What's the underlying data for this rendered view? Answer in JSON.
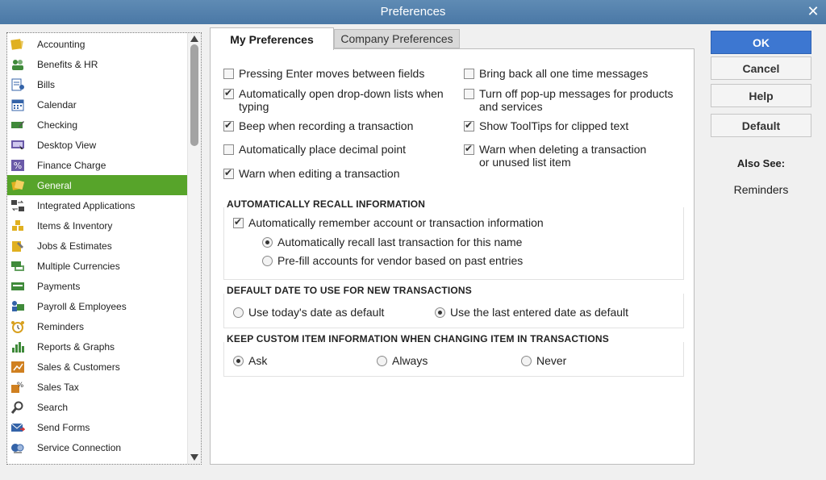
{
  "window": {
    "title": "Preferences",
    "close_glyph": "✕"
  },
  "sidebar": {
    "items": [
      {
        "label": "Accounting",
        "icon": "accounting-icon",
        "color": "#e0b020"
      },
      {
        "label": "Benefits & HR",
        "icon": "people-icon",
        "color": "#3f8a3a"
      },
      {
        "label": "Bills",
        "icon": "bills-icon",
        "color": "#3463a8"
      },
      {
        "label": "Calendar",
        "icon": "calendar-icon",
        "color": "#3463a8"
      },
      {
        "label": "Checking",
        "icon": "checking-icon",
        "color": "#3f8a3a"
      },
      {
        "label": "Desktop View",
        "icon": "desktop-icon",
        "color": "#6a5aa8"
      },
      {
        "label": "Finance Charge",
        "icon": "percent-icon",
        "color": "#6a5aa8"
      },
      {
        "label": "General",
        "icon": "general-icon",
        "color": "#e0b020"
      },
      {
        "label": "Integrated Applications",
        "icon": "integrated-apps-icon",
        "color": "#444"
      },
      {
        "label": "Items & Inventory",
        "icon": "inventory-icon",
        "color": "#e0b020"
      },
      {
        "label": "Jobs & Estimates",
        "icon": "jobs-icon",
        "color": "#e0b020"
      },
      {
        "label": "Multiple Currencies",
        "icon": "currencies-icon",
        "color": "#3f8a3a"
      },
      {
        "label": "Payments",
        "icon": "payments-icon",
        "color": "#3f8a3a"
      },
      {
        "label": "Payroll & Employees",
        "icon": "payroll-icon",
        "color": "#3f8a3a"
      },
      {
        "label": "Reminders",
        "icon": "alarm-clock-icon",
        "color": "#d8a020"
      },
      {
        "label": "Reports & Graphs",
        "icon": "bar-chart-icon",
        "color": "#3f8a3a"
      },
      {
        "label": "Sales & Customers",
        "icon": "sales-icon",
        "color": "#d08020"
      },
      {
        "label": "Sales Tax",
        "icon": "sales-tax-icon",
        "color": "#d08020"
      },
      {
        "label": "Search",
        "icon": "search-icon",
        "color": "#444"
      },
      {
        "label": "Send Forms",
        "icon": "send-forms-icon",
        "color": "#3463a8"
      },
      {
        "label": "Service Connection",
        "icon": "service-connection-icon",
        "color": "#3463a8"
      }
    ],
    "selected_index": 7
  },
  "tabs": [
    {
      "label": "My Preferences",
      "active": true
    },
    {
      "label": "Company Preferences",
      "active": false
    }
  ],
  "options": {
    "left": [
      {
        "label": "Pressing Enter moves between fields",
        "checked": false
      },
      {
        "label": "Automatically open drop-down lists when typing",
        "checked": true
      },
      {
        "label": "Beep when recording a transaction",
        "checked": true
      },
      {
        "label": "Automatically place decimal point",
        "checked": false
      },
      {
        "label": "Warn when editing a transaction",
        "checked": true
      }
    ],
    "right": [
      {
        "label": "Bring back all one time messages",
        "checked": false
      },
      {
        "label": "Turn off pop-up messages for products and services",
        "checked": false
      },
      {
        "label": "Show ToolTips for clipped text",
        "checked": true
      },
      {
        "label": "Warn when deleting a transaction or unused list item",
        "checked": true
      }
    ]
  },
  "recall": {
    "title": "AUTOMATICALLY RECALL INFORMATION",
    "remember_label": "Automatically remember account or transaction information",
    "remember_checked": true,
    "options": [
      {
        "label": "Automatically recall last transaction for this name",
        "checked": true
      },
      {
        "label": "Pre-fill accounts for vendor based on past entries",
        "checked": false
      }
    ]
  },
  "default_date": {
    "title": "DEFAULT DATE TO USE FOR NEW TRANSACTIONS",
    "options": [
      {
        "label": "Use today's date as default",
        "checked": false
      },
      {
        "label": "Use the last entered date as default",
        "checked": true
      }
    ]
  },
  "custom_item": {
    "title": "KEEP CUSTOM ITEM INFORMATION WHEN CHANGING ITEM IN TRANSACTIONS",
    "options": [
      {
        "label": "Ask",
        "checked": true
      },
      {
        "label": "Always",
        "checked": false
      },
      {
        "label": "Never",
        "checked": false
      }
    ]
  },
  "buttons": {
    "ok": "OK",
    "cancel": "Cancel",
    "help": "Help",
    "default": "Default"
  },
  "also_see": {
    "title": "Also See:",
    "link": "Reminders"
  },
  "colors": {
    "titlebar": "#4a78a6",
    "selected": "#57a42a",
    "primary": "#3d77d1"
  }
}
